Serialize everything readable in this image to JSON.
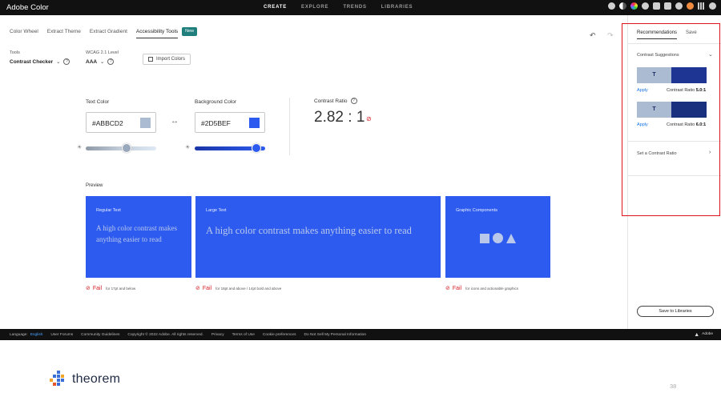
{
  "topbar": {
    "brand": "Adobe Color",
    "nav": [
      "CREATE",
      "EXPLORE",
      "TRENDS",
      "LIBRARIES"
    ],
    "active_nav": "CREATE"
  },
  "subtabs": {
    "items": [
      "Color Wheel",
      "Extract Theme",
      "Extract Gradient",
      "Accessibility Tools"
    ],
    "active": "Accessibility Tools",
    "badge": "New"
  },
  "tools": {
    "label": "Tools",
    "value": "Contrast Checker",
    "wcag_label": "WCAG 2.1 Level",
    "wcag_value": "AAA",
    "import_label": "Import Colors"
  },
  "checker": {
    "text_color_label": "Text Color",
    "text_color_value": "#ABBCD2",
    "text_color_hex": "#abbcd2",
    "background_color_label": "Background Color",
    "background_color_value": "#2D5BEF",
    "background_color_hex": "#2d5bef",
    "text_slider_level": 0.58,
    "bg_slider_level": 0.88,
    "contrast_ratio_label": "Contrast Ratio",
    "contrast_ratio_value": "2.82 : 1"
  },
  "preview": {
    "label": "Preview",
    "regular_title": "Regular Text",
    "regular_text": "A high color contrast makes anything easier to read",
    "large_title": "Large Text",
    "large_text": "A high color contrast makes anything easier to read",
    "graphic_title": "Graphic Components",
    "fail_word": "Fail",
    "regular_note": "for 17pt and below",
    "large_note": "for 18pt and above / 14pt bold and above",
    "graphic_note": "for icons and actionable graphics"
  },
  "right_panel": {
    "tabs": [
      "Recommendations",
      "Save"
    ],
    "active_tab": "Recommendations",
    "suggestions_label": "Contrast Suggestions",
    "suggestion_glyph": "T",
    "apply_label": "Apply",
    "ratio_prefix": "Contrast Ratio",
    "suggestion_1_ratio": "5.0:1",
    "suggestion_2_ratio": "6.0:1",
    "set_ratio_label": "Set a Contrast Ratio",
    "save_button": "Save to Libraries"
  },
  "footer": {
    "language_label": "Language:",
    "language_value": "English",
    "links": [
      "User Forums",
      "Community Guidelines",
      "Copyright © 2022 Adobe. All rights reserved.",
      "Privacy",
      "Terms of Use",
      "Cookie preferences",
      "Do Not Sell My Personal Information"
    ],
    "adobe": "Adobe"
  },
  "slide": {
    "logo_text": "theorem",
    "page_number": "38"
  },
  "colors": {
    "accent_blue": "#2d5bef",
    "highlight_red": "#e0131b",
    "fail_red": "#d8232a",
    "teal_badge": "#1f7f7c"
  }
}
